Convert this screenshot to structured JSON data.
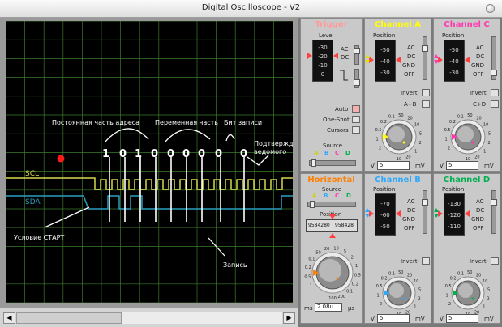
{
  "window": {
    "title": "Digital Oscilloscope - V2"
  },
  "screen": {
    "labels": {
      "const_addr": "Постоянная часть адреса",
      "var_part": "Переменная часть",
      "write_bit": "Бит записи",
      "ack_line1": "Подтверждение от",
      "ack_line2": "ведомого",
      "start": "Условие СТАРТ",
      "write": "Запись",
      "scl": "SCL",
      "sda": "SDA"
    },
    "bits": [
      "1",
      "0",
      "1",
      "0",
      "0",
      "0",
      "0",
      "0"
    ]
  },
  "trigger": {
    "title": "Trigger",
    "level_label": "Level",
    "scale": [
      "-30",
      "-20",
      "-10",
      "0"
    ],
    "ac": "AC",
    "dc": "DC",
    "auto": "Auto",
    "oneshot": "One-Shot",
    "cursors": "Cursors",
    "source": "Source",
    "src_letters": [
      "A",
      "B",
      "C",
      "D"
    ]
  },
  "channel_a": {
    "title": "Channel A",
    "position": "Position",
    "scale": [
      "-50",
      "-40",
      "-30"
    ],
    "ac": "AC",
    "dc": "DC",
    "gnd": "GND",
    "off": "OFF",
    "invert": "Invert",
    "mix": "A+B",
    "readout": "5",
    "unit_v": "V",
    "unit_mv": "mV",
    "dial": [
      "2",
      "1",
      "0.5",
      "0.2",
      "0.1",
      "50",
      "20",
      "10",
      "5",
      "2",
      "1",
      "20",
      "10"
    ]
  },
  "channel_c": {
    "title": "Channel C",
    "position": "Position",
    "scale": [
      "-50",
      "-40",
      "-30"
    ],
    "ac": "AC",
    "dc": "DC",
    "gnd": "GND",
    "off": "OFF",
    "invert": "Invert",
    "mix": "C+D",
    "readout": "5",
    "unit_v": "V",
    "unit_mv": "mV",
    "dial": [
      "2",
      "1",
      "0.5",
      "0.2",
      "0.1",
      "50",
      "20",
      "10",
      "5",
      "2",
      "1",
      "20",
      "10"
    ]
  },
  "horizontal": {
    "title": "Horizontal",
    "source": "Source",
    "src_letters": [
      "A",
      "B",
      "C",
      "D"
    ],
    "position": "Position",
    "pos_readout_a": "9584280",
    "pos_readout_b": "958428",
    "readout": "2.08u",
    "unit_ms": "ms",
    "unit_us": "μs",
    "dial": [
      "1",
      "0.5",
      "0.2",
      "0.1",
      "50",
      "20",
      "10",
      "5",
      "2",
      "1",
      "0.5",
      "0.2",
      "0.1",
      "200",
      "100"
    ]
  },
  "channel_b": {
    "title": "Channel B",
    "position": "Position",
    "scale": [
      "-70",
      "-60",
      "-50"
    ],
    "ac": "AC",
    "dc": "DC",
    "gnd": "GND",
    "off": "OFF",
    "invert": "Invert",
    "readout": "5",
    "unit_v": "V",
    "unit_mv": "mV",
    "dial": [
      "2",
      "1",
      "0.5",
      "0.2",
      "0.1",
      "50",
      "20",
      "10",
      "5",
      "2",
      "1",
      "20",
      "10"
    ]
  },
  "channel_d": {
    "title": "Channel D",
    "position": "Position",
    "scale": [
      "-130",
      "-120",
      "-110"
    ],
    "ac": "AC",
    "dc": "DC",
    "gnd": "GND",
    "off": "OFF",
    "invert": "Invert",
    "readout": "5",
    "unit_v": "V",
    "unit_mv": "mV",
    "dial": [
      "2",
      "1",
      "0.5",
      "0.2",
      "0.1",
      "50",
      "20",
      "10",
      "5",
      "2",
      "1",
      "20",
      "10"
    ]
  },
  "colors": {
    "trigger": "#ff9a9a",
    "a": "#ffff00",
    "b": "#2ea8ff",
    "c": "#ff3ab0",
    "d": "#00b050",
    "horizontal": "#ff8000",
    "grid": "#3c7a2a",
    "scl": "#d8d84a",
    "sda": "#2aa0c0"
  },
  "icons": {
    "close": "close-circle-icon",
    "left": "left-arrow-icon",
    "right": "right-arrow-icon"
  }
}
